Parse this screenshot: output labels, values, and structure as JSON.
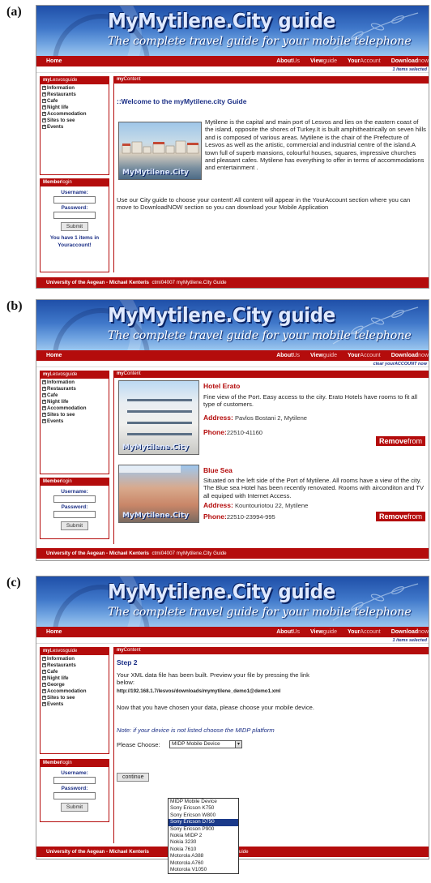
{
  "panels": [
    {
      "tag": "(a)",
      "banner": {
        "title": "MyMytilene.City guide",
        "subtitle": "The complete travel guide for your mobile telephone"
      },
      "nav": {
        "home": "Home",
        "about_a": "About",
        "about_b": "Us",
        "view_a": "View",
        "view_b": "guide",
        "your_a": "Your",
        "your_b": "Account",
        "download_a": "Download",
        "download_b": "now"
      },
      "subnav": "1 items selected",
      "sidebar_head_a": "my",
      "sidebar_head_b": "Lesvosguide",
      "menu": [
        "Information",
        "Restaurants",
        "Cafe",
        "Night life",
        "Accommodation",
        "Sites to see",
        "Events"
      ],
      "member_a": "Member",
      "member_b": "login",
      "username": "Username:",
      "password": "Password:",
      "submit": "Submit",
      "note": "You have 1 items in Youraccount!",
      "main_head_a": "my",
      "main_head_b": "Content",
      "welcome": "::Welcome to the myMytilene.city Guide",
      "photo_wm": "MyMytilene.City",
      "intro": "Mytilene is the capital and main port of Lesvos and lies on the eastern coast of the island, opposite the shores of Turkey.It is built amphitheatrically on seven hills and is composed of various areas. Mytilene is the chair of the Prefecture of Lesvos as well as the artistic, commercial and industrial centre of the island.A town full of superb mansions, colourful houses, squares, impressive churches and pleasant cafes. Mytilene has everything to offer in terms of accommodations and entertainment .",
      "usage": "Use our City guide to choose your content! All content will appear in the YourAccount section where you can move to DownloadNOW section so you can download your Mobile Application",
      "footer_a": "University of the Aegean - Michael Kenteris",
      "footer_b": "ctmi04007 myMytilene.City Guide"
    },
    {
      "tag": "(b)",
      "banner": {
        "title": "MyMytilene.City guide",
        "subtitle": "The complete travel guide for your mobile telephone"
      },
      "nav": {
        "home": "Home",
        "about_a": "About",
        "about_b": "Us",
        "view_a": "View",
        "view_b": "guide",
        "your_a": "Your",
        "your_b": "Account",
        "download_a": "Download",
        "download_b": "now"
      },
      "subnav": "clear yourACCOUNT now",
      "sidebar_head_a": "my",
      "sidebar_head_b": "Lesvosguide",
      "menu": [
        "Information",
        "Restaurants",
        "Cafe",
        "Night life",
        "Accommodation",
        "Sites to see",
        "Events"
      ],
      "member_a": "Member",
      "member_b": "login",
      "username": "Username:",
      "password": "Password:",
      "submit": "Submit",
      "main_head_a": "my",
      "main_head_b": "Content",
      "hotels": [
        {
          "name": "Hotel Erato",
          "desc": "Fine view of the Port. Easy access to the city. Erato Hotels have rooms to fit all type of customers.",
          "addr_label": "Address:",
          "addr": "Pavlos Bostani 2, Mytilene",
          "phone_label": "Phone:",
          "phone": "22510-41160",
          "remove_a": "Remove",
          "remove_b": "from",
          "wm": "MyMytilene.City"
        },
        {
          "name": "Blue Sea",
          "desc": "Situated on the left side of the Port of Mytilene. All rooms have a view of the city. The Blue sea Hotel has been recently renovated. Rooms with airconditon and TV all equiped with Internet Access.",
          "addr_label": "Address:",
          "addr": "Kountouriotou 22, Mytilene",
          "phone_label": "Phone:",
          "phone": "22510-23994-995",
          "remove_a": "Remove",
          "remove_b": "from",
          "wm": "MyMytilene.City"
        }
      ],
      "footer_a": "University of the Aegean - Michael Kenteris",
      "footer_b": "ctmi04007 myMytilene.City Guide"
    },
    {
      "tag": "(c)",
      "banner": {
        "title": "MyMytilene.City guide",
        "subtitle": "The complete travel guide for your mobile telephone"
      },
      "nav": {
        "home": "Home",
        "about_a": "About",
        "about_b": "Us",
        "view_a": "View",
        "view_b": "guide",
        "your_a": "Your",
        "your_b": "Account",
        "download_a": "Download",
        "download_b": "now"
      },
      "subnav": "1 items selected",
      "sidebar_head_a": "my",
      "sidebar_head_b": "Lesvosguide",
      "menu": [
        "Information",
        "Restaurants",
        "Cafe",
        "Night life",
        "George",
        "Accommodation",
        "Sites to see",
        "Events"
      ],
      "member_a": "Member",
      "member_b": "login",
      "username": "Username:",
      "password": "Password:",
      "submit": "Submit",
      "main_head_a": "my",
      "main_head_b": "Content",
      "step": "Step 2",
      "built": "Your XML data file has been built. Preview your file by pressing the link below:",
      "link": "http://192.168.1.7/lesvos/downloads/mymytilene_demo1@demo1.xml",
      "choose": "Now that you have chosen your data, please choose your mobile device.",
      "note": "Note: if your device is not listed choose the MIDP platform",
      "please": "Please Choose:",
      "selected": "MIDP Mobile Device",
      "options": [
        "MIDP Mobile Device",
        "Sony Ericson K750",
        "Sony Ericson W800",
        "Sony Ericson D750",
        "Sony Ericson P900",
        "Nokia MIDP 2",
        "Nokia 3230",
        "Nokia 7610",
        "Motorola A388",
        "Motorola A760",
        "Motorola V1050"
      ],
      "highlight_index": 3,
      "continue": "continue",
      "footer_a": "University of the Aegean - Michael Kenteris",
      "footer_b": ".City Guide"
    }
  ]
}
